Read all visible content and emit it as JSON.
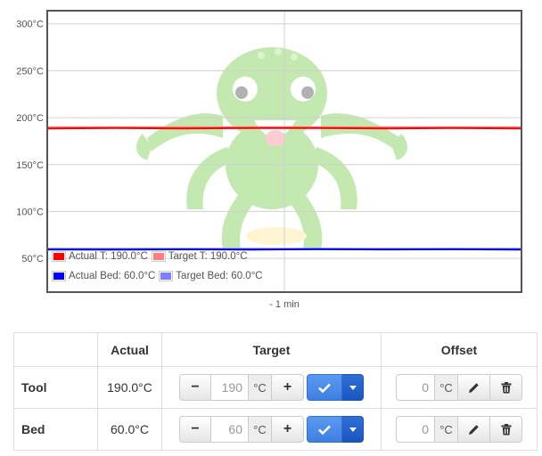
{
  "chart_data": {
    "type": "line",
    "y_tick_labels": [
      "300°C",
      "250°C",
      "200°C",
      "150°C",
      "100°C",
      "50°C"
    ],
    "y_tick_values": [
      300,
      250,
      200,
      150,
      100,
      50
    ],
    "ylim": [
      15,
      313
    ],
    "x_tick_labels": [
      "- 1 min"
    ],
    "x_tick_values": [
      -1
    ],
    "xlim": [
      -1.7,
      -0.3
    ],
    "grid": true,
    "legend_placement": "bottom-left",
    "series": [
      {
        "name": "Actual T: 190.0°C",
        "color": "#ff0000",
        "x": [
          -1.7,
          -1.5,
          -1.3,
          -1.1,
          -0.9,
          -0.7,
          -0.5,
          -0.3
        ],
        "y": [
          188.5,
          189,
          188.5,
          189,
          189,
          188.5,
          189,
          188.5
        ]
      },
      {
        "name": "Target T: 190.0°C",
        "color": "#ff7f7f",
        "x": [
          -1.7,
          -0.3
        ],
        "y": [
          189.5,
          189.5
        ]
      },
      {
        "name": "Actual Bed: 60.0°C",
        "color": "#0000ff",
        "x": [
          -1.7,
          -1.5,
          -1.3,
          -1.1,
          -0.9,
          -0.7,
          -0.5,
          -0.3
        ],
        "y": [
          59.5,
          59.3,
          59.6,
          59.4,
          59.8,
          59.5,
          59.7,
          59.4
        ]
      },
      {
        "name": "Target Bed: 60.0°C",
        "color": "#7f7fff",
        "x": [
          -1.7,
          -0.3
        ],
        "y": [
          60,
          60
        ]
      }
    ]
  },
  "table": {
    "headers": {
      "blank": "",
      "actual": "Actual",
      "target": "Target",
      "offset": "Offset"
    },
    "rows": [
      {
        "label": "Tool",
        "actual": "190.0°C",
        "target": "190",
        "offset": "0"
      },
      {
        "label": "Bed",
        "actual": "60.0°C",
        "target": "60",
        "offset": "0"
      }
    ],
    "unit": "°C",
    "minus_label": "−",
    "plus_label": "+"
  },
  "icons": {
    "set": "check-icon",
    "caret": "caret-down-icon",
    "edit": "pencil-icon",
    "delete": "trash-icon",
    "watermark": "octopus-logo"
  },
  "colors": {
    "primary": "#3f7fe0",
    "primary_dark": "#1a56c0"
  }
}
